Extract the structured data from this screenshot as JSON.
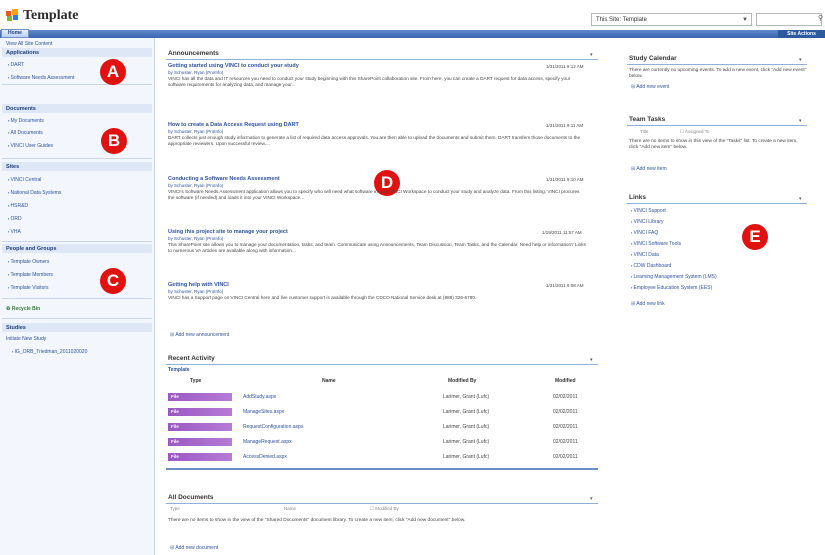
{
  "header": {
    "site_title": "Template",
    "scope_select": "This Site: Template",
    "home_tab": "Home",
    "site_actions": "Site Actions"
  },
  "quicklaunch": {
    "view_all": "View All Site Content",
    "applications_head": "Applications",
    "applications": [
      "DART",
      "Software Needs Assessment"
    ],
    "documents_head": "Documents",
    "documents": [
      "My Documents",
      "All Documents",
      "VINCI User Guides"
    ],
    "sites_head": "Sites",
    "sites": [
      "VINCI Central",
      "National Data Systems",
      "HSR&D",
      "ORD",
      "VHA"
    ],
    "people_head": "People and Groups",
    "people": [
      "Template Owners",
      "Template Members",
      "Template Visitors"
    ],
    "recycle_bin": "Recycle Bin",
    "studies_head": "Studies",
    "initiate_study": "Initiate New Study",
    "studies": [
      "IG_ORB_Triedman_2011020020"
    ]
  },
  "badges": {
    "a": "A",
    "b": "B",
    "c": "C",
    "d": "D",
    "e": "E"
  },
  "announcements": {
    "title": "Announcements",
    "items": [
      {
        "title": "Getting started using VINCI to conduct your study",
        "by": "by Schuster, Ryan (ProInfo)",
        "date": "1/31/2011 9:12 AM",
        "body": "VINCI has all the data and IT resources you need to conduct your study beginning with this SharePoint collaboration site. From here, you can create a DART request for data access, specify your software requirements for analyzing data, and manage your..."
      },
      {
        "title": "How to create a Data Access Request using DART",
        "by": "by Schuster, Ryan (ProInfo)",
        "date": "1/31/2011 9:11 AM",
        "body": "DART collects just enough study information to generate a list of required data access approvals. You are then able to upload the documents and submit them. DART transfers those documents to the appropriate reviewers. Upon successful review,..."
      },
      {
        "title": "Conducting a Software Needs Assessment",
        "by": "by Schuster, Ryan (ProInfo)",
        "date": "1/31/2011 9:10 AM",
        "body": "VINCI's Software Needs Assessment application allows you to specify who will need what software in your VINCI Workspace to conduct your study and analyze data. From this listing, VINCI procures the software (if needed) and loads it into your VINCI Workspace..."
      },
      {
        "title": "Using this project site to manage your project",
        "by": "by Schuster, Ryan (ProInfo)",
        "date": "1/19/2011 11:57 AM",
        "body": "This SharePoint site allows you to manage your documentation, tasks, and team. Communicate using Announcements, Team Discussion, Team Tasks, and the Calendar. Need help or information? Links to numerous VA articles are available along with information..."
      },
      {
        "title": "Getting help with VINCI",
        "by": "by Schuster, Ryan (ProInfo)",
        "date": "1/31/2011 9:08 AM",
        "body": "VINCI has a Support page on VINCI Central here and live customer support is available through the CDCO National Service desk at (888) 326-6780."
      }
    ],
    "add_link": "Add new announcement"
  },
  "recent_activity": {
    "title": "Recent Activity",
    "subtitle": "Template",
    "columns": [
      "Type",
      "Name",
      "Modified By",
      "Modified"
    ],
    "rows": [
      {
        "type": "File",
        "name": "AddStudy.aspx",
        "by": "Larimer, Grant (Lufc)",
        "modified": "02/02/2011"
      },
      {
        "type": "File",
        "name": "ManageSites.aspx",
        "by": "Larimer, Grant (Lufc)",
        "modified": "02/02/2011"
      },
      {
        "type": "File",
        "name": "RequestConfiguration.aspx",
        "by": "Larimer, Grant (Lufc)",
        "modified": "02/02/2011"
      },
      {
        "type": "File",
        "name": "ManageRequest.aspx",
        "by": "Larimer, Grant (Lufc)",
        "modified": "02/02/2011"
      },
      {
        "type": "File",
        "name": "AccessDenied.aspx",
        "by": "Larimer, Grant (Lufc)",
        "modified": "02/02/2011"
      }
    ]
  },
  "all_documents": {
    "title": "All Documents",
    "columns": [
      "Type",
      "Name",
      "Modified By"
    ],
    "empty_text": "There are no items to show in the view of the \"Shared Documents\" document library. To create a new item, click \"Add new document\" below.",
    "add_link": "Add new document"
  },
  "study_calendar": {
    "title": "Study Calendar",
    "empty_text": "There are currently no upcoming events. To add a new event, click \"Add new event\" below.",
    "add_link": "Add new event"
  },
  "team_tasks": {
    "title": "Team Tasks",
    "columns": [
      "Title",
      "Assigned To"
    ],
    "empty_text": "There are no items to show in this view of the \"Tasks\" list. To create a new item, click \"Add new item\" below.",
    "add_link": "Add new item"
  },
  "links": {
    "title": "Links",
    "items": [
      "VINCI Support",
      "VINCI Library",
      "VINCI FAQ",
      "VINCI Software Tools",
      "VINCI Data",
      "CDW Dashboard",
      "Learning Management System (LMS)",
      "Employee Education System (EES)"
    ],
    "add_link": "Add new link"
  },
  "colors": {
    "accent": "#3a66b0",
    "badge": "#e0120f",
    "chip": "#9b57c2",
    "link": "#2c52a0"
  }
}
